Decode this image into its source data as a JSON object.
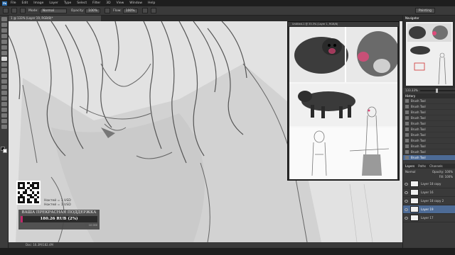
{
  "app": {
    "logo": "Ps",
    "menu": [
      "File",
      "Edit",
      "Image",
      "Layer",
      "Type",
      "Select",
      "Filter",
      "3D",
      "View",
      "Window",
      "Help"
    ]
  },
  "options_bar": {
    "mode_label": "Mode:",
    "mode_value": "Normal",
    "opacity_label": "Opacity:",
    "opacity_value": "100%",
    "flow_label": "Flow:",
    "flow_value": "100%",
    "workspace": "Painting"
  },
  "document": {
    "tab_title": "1 @ 133% (Layer 19, RGB/8)*",
    "reference_window_title": "Untitled-1 @ 33.3% (Layer 1, RGB/8)",
    "status_text": "Doc: 16.3M/182.4M"
  },
  "stream_overlay": {
    "donate_line_1": "Ноктей = 1 USD",
    "donate_line_2": "Ноктей = 1 USD",
    "title": "ВАША ПРЕКРАСНАЯ ПОДДЕРЖКА",
    "amount": "180.26 RUB (2%)",
    "progress_fraction": 0.02,
    "goal": "10 000",
    "fill_color": "#c0286a"
  },
  "navigator": {
    "tab_label": "Navigator",
    "zoom": "133.33%"
  },
  "history": {
    "tab_label": "History",
    "items": [
      "Brush Tool",
      "Brush Tool",
      "Brush Tool",
      "Brush Tool",
      "Brush Tool",
      "Brush Tool",
      "Brush Tool",
      "Brush Tool",
      "Brush Tool",
      "Brush Tool",
      "Brush Tool"
    ],
    "selected_index": 10
  },
  "layers": {
    "tabs": [
      "Layers",
      "Paths",
      "Channels"
    ],
    "blend_mode": "Normal",
    "opacity_label": "Opacity:",
    "opacity_value": "100%",
    "fill_label": "Fill:",
    "fill_value": "100%",
    "items": [
      "Layer 18 copy",
      "Layer 16",
      "Layer 18 copy 2",
      "Layer 19",
      "Layer 17"
    ],
    "selected_index": 3
  }
}
